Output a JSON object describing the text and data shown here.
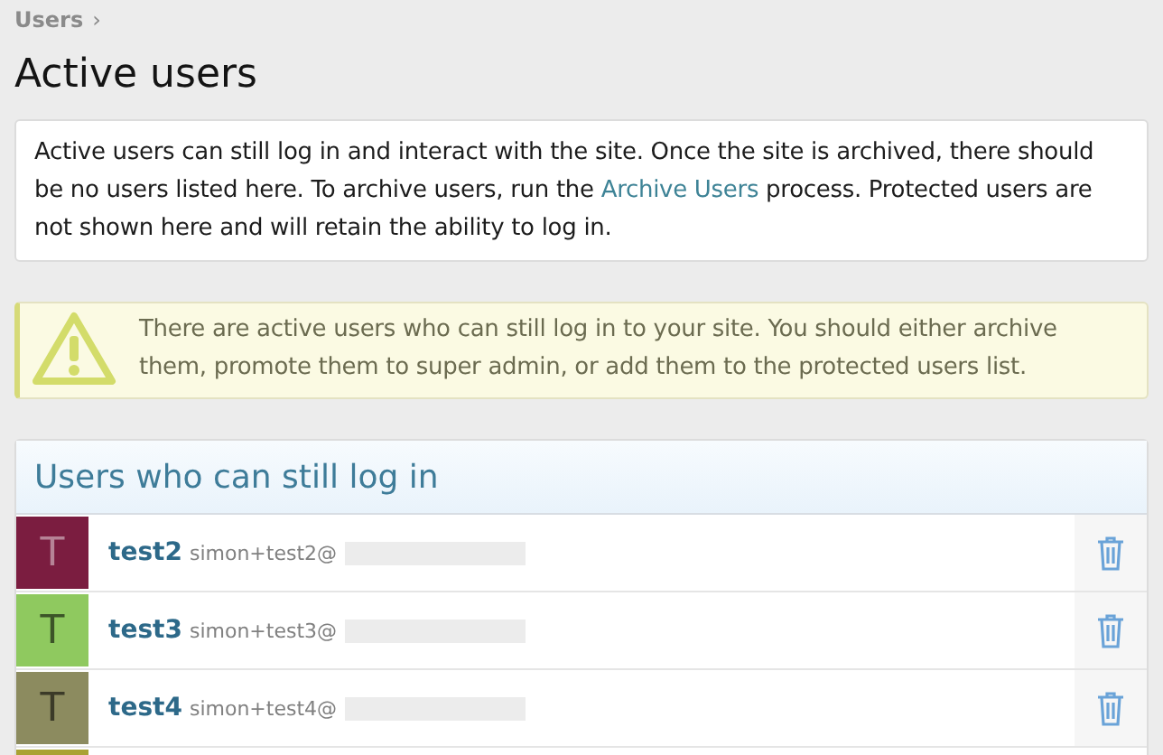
{
  "breadcrumb": {
    "label": "Users",
    "separator": "›"
  },
  "title": "Active users",
  "info": {
    "before": "Active users can still log in and interact with the site. Once the site is archived, there should be no users listed here. To archive users, run the ",
    "link": "Archive Users",
    "after": " process. Protected users are not shown here and will retain the ability to log in."
  },
  "warning": "There are active users who can still log in to your site. You should either archive them, promote them to super admin, or add them to the protected users list.",
  "panel": {
    "title": "Users who can still log in",
    "users": [
      {
        "initial": "T",
        "color": "#7b1d40",
        "name": "test2",
        "email": "simon+test2@"
      },
      {
        "initial": "T",
        "color": "#8fc95f",
        "name": "test3",
        "email": "simon+test3@"
      },
      {
        "initial": "T",
        "color": "#8c8b5f",
        "name": "test4",
        "email": "simon+test4@"
      },
      {
        "color": "#a9a233"
      }
    ]
  }
}
